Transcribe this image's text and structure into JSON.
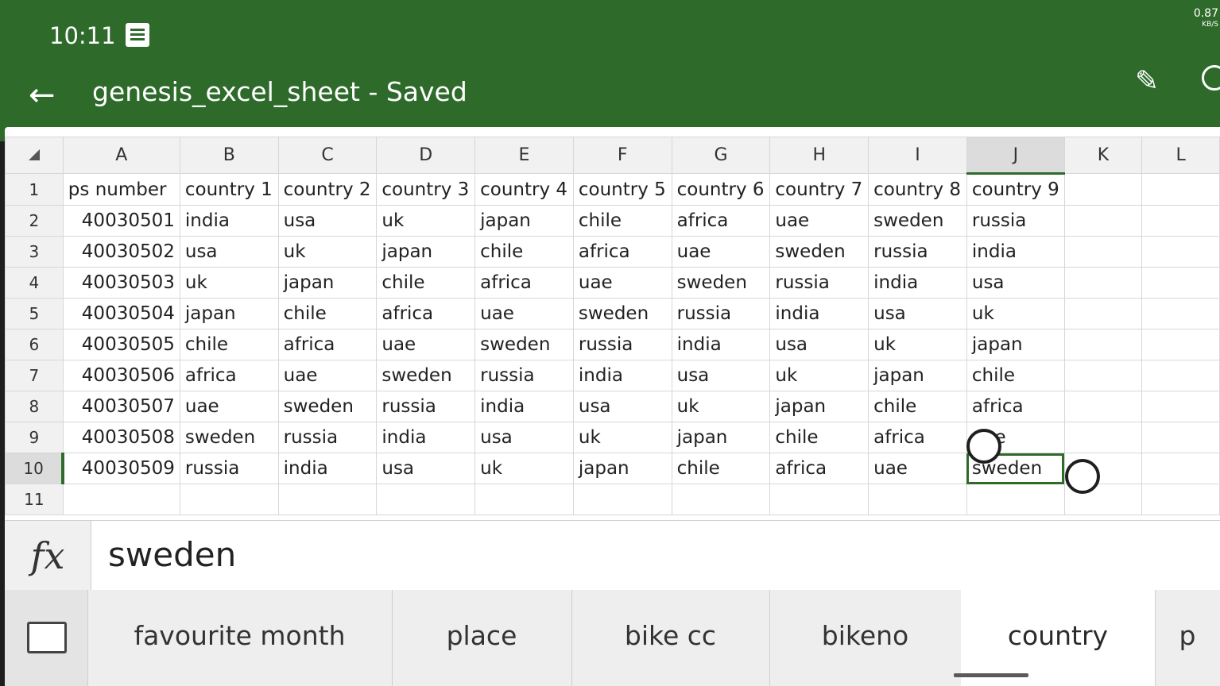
{
  "status": {
    "time": "10:11",
    "net_value": "0.87",
    "net_unit": "KB/S"
  },
  "header": {
    "title": "genesis_excel_sheet - Saved"
  },
  "grid": {
    "columns": [
      "A",
      "B",
      "C",
      "D",
      "E",
      "F",
      "G",
      "H",
      "I",
      "J",
      "K",
      "L"
    ],
    "selected_column": "J",
    "selected_row": "10",
    "rows": [
      {
        "num": "1",
        "cells": [
          "ps number",
          "country 1",
          "country 2",
          "country 3",
          "country 4",
          "country 5",
          "country 6",
          "country 7",
          "country 8",
          "country 9",
          "",
          ""
        ]
      },
      {
        "num": "2",
        "cells": [
          "40030501",
          "india",
          "usa",
          "uk",
          "japan",
          "chile",
          "africa",
          "uae",
          "sweden",
          "russia",
          "",
          ""
        ]
      },
      {
        "num": "3",
        "cells": [
          "40030502",
          "usa",
          "uk",
          "japan",
          "chile",
          "africa",
          "uae",
          "sweden",
          "russia",
          "india",
          "",
          ""
        ]
      },
      {
        "num": "4",
        "cells": [
          "40030503",
          "uk",
          "japan",
          "chile",
          "africa",
          "uae",
          "sweden",
          "russia",
          "india",
          "usa",
          "",
          ""
        ]
      },
      {
        "num": "5",
        "cells": [
          "40030504",
          "japan",
          "chile",
          "africa",
          "uae",
          "sweden",
          "russia",
          "india",
          "usa",
          "uk",
          "",
          ""
        ]
      },
      {
        "num": "6",
        "cells": [
          "40030505",
          "chile",
          "africa",
          "uae",
          "sweden",
          "russia",
          "india",
          "usa",
          "uk",
          "japan",
          "",
          ""
        ]
      },
      {
        "num": "7",
        "cells": [
          "40030506",
          "africa",
          "uae",
          "sweden",
          "russia",
          "india",
          "usa",
          "uk",
          "japan",
          "chile",
          "",
          ""
        ]
      },
      {
        "num": "8",
        "cells": [
          "40030507",
          "uae",
          "sweden",
          "russia",
          "india",
          "usa",
          "uk",
          "japan",
          "chile",
          "africa",
          "",
          ""
        ]
      },
      {
        "num": "9",
        "cells": [
          "40030508",
          "sweden",
          "russia",
          "india",
          "usa",
          "uk",
          "japan",
          "chile",
          "africa",
          "uae",
          "",
          ""
        ]
      },
      {
        "num": "10",
        "cells": [
          "40030509",
          "russia",
          "india",
          "usa",
          "uk",
          "japan",
          "chile",
          "africa",
          "uae",
          "sweden",
          "",
          ""
        ]
      },
      {
        "num": "11",
        "cells": [
          "",
          "",
          "",
          "",
          "",
          "",
          "",
          "",
          "",
          "",
          "",
          ""
        ]
      }
    ]
  },
  "formula_bar": {
    "icon_label": "fx",
    "value": "sweden"
  },
  "sheet_tabs": {
    "tabs": [
      {
        "label": "favourite month",
        "active": false
      },
      {
        "label": "place",
        "active": false
      },
      {
        "label": "bike cc",
        "active": false
      },
      {
        "label": "bikeno",
        "active": false
      },
      {
        "label": "country",
        "active": true
      },
      {
        "label": "p",
        "active": false
      }
    ]
  },
  "colors": {
    "accent": "#2e6b2b"
  }
}
